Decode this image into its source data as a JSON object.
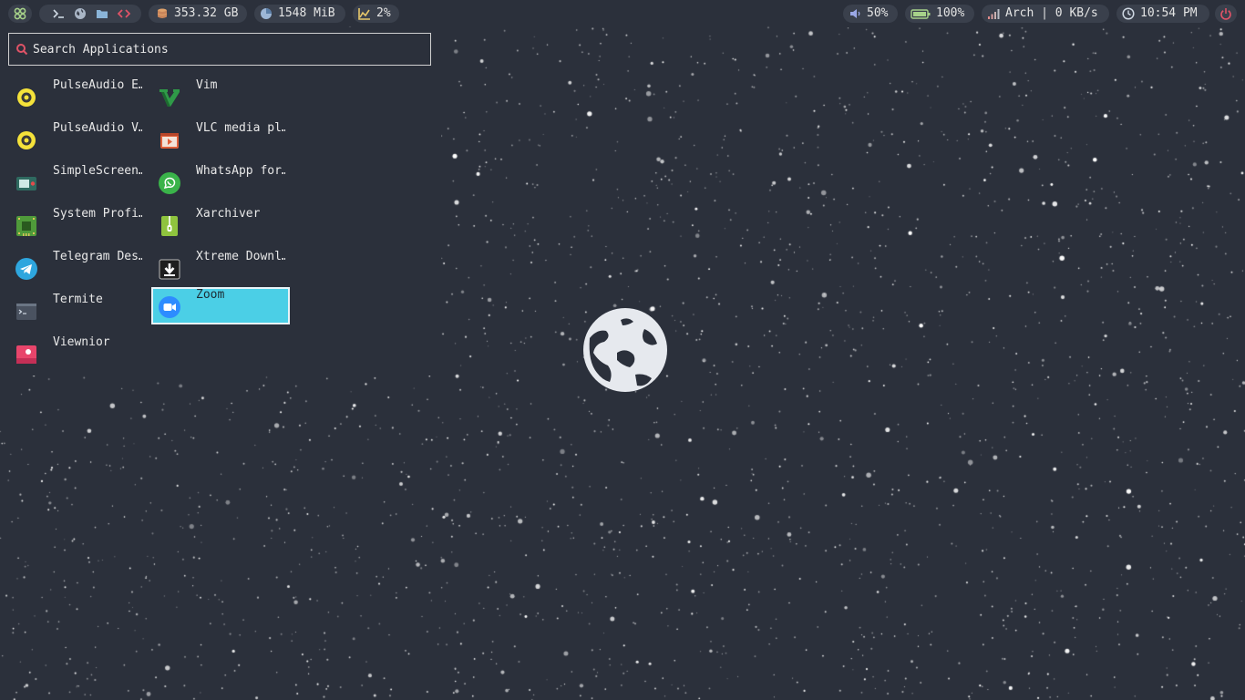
{
  "topbar": {
    "left": {
      "disk": "353.32 GB",
      "memory": "1548 MiB",
      "cpu": "2%"
    },
    "right": {
      "volume": "50%",
      "battery": "100%",
      "network": "Arch | 0 KB/s",
      "clock": "10:54 PM"
    },
    "icons": [
      "apps-icon",
      "terminal-icon",
      "globe-icon",
      "folder-icon",
      "code-icon",
      "disk-icon",
      "memory-icon",
      "cpu-icon",
      "volume-icon",
      "battery-icon",
      "wifi-icon",
      "clock-icon",
      "power-icon"
    ]
  },
  "launcher": {
    "search_placeholder": "Search Applications",
    "apps_col1": [
      {
        "label": "PulseAudio E…",
        "icon": "pulseaudio-icon"
      },
      {
        "label": "PulseAudio V…",
        "icon": "pulseaudio-icon"
      },
      {
        "label": "SimpleScreen…",
        "icon": "screen-recorder-icon"
      },
      {
        "label": "System Profi…",
        "icon": "chip-icon"
      },
      {
        "label": "Telegram Des…",
        "icon": "telegram-icon"
      },
      {
        "label": "Termite",
        "icon": "terminal-window-icon"
      },
      {
        "label": "Viewnior",
        "icon": "image-viewer-icon"
      }
    ],
    "apps_col2": [
      {
        "label": "Vim",
        "icon": "vim-icon"
      },
      {
        "label": "VLC media pl…",
        "icon": "vlc-icon"
      },
      {
        "label": "WhatsApp for…",
        "icon": "whatsapp-icon"
      },
      {
        "label": "Xarchiver",
        "icon": "archive-icon"
      },
      {
        "label": "Xtreme Downl…",
        "icon": "download-icon"
      },
      {
        "label": "Zoom",
        "icon": "zoom-icon",
        "selected": true
      }
    ],
    "selected_color": "#4bcfe6"
  },
  "colors": {
    "background": "#2b303b",
    "pill": "#3a404c",
    "accent_red": "#e05367"
  }
}
